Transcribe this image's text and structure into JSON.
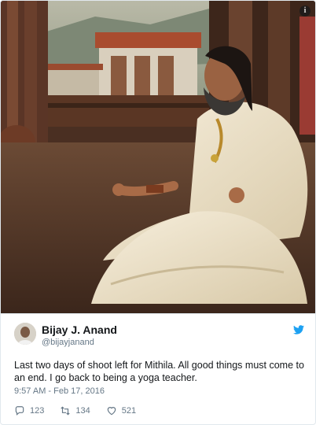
{
  "photo": {
    "info_icon": "info-icon"
  },
  "tweet": {
    "author": {
      "name": "Bijay J. Anand",
      "handle": "@bijayjanand",
      "avatar_icon": "avatar"
    },
    "text": "Last two days of shoot left for Mithila. All good things must come to an end. I go back to being a yoga teacher.",
    "timestamp": "9:57 AM - Feb 17, 2016",
    "actions": {
      "reply_count": "123",
      "retweet_count": "134",
      "like_count": "521"
    },
    "brand_color": "#1da1f2"
  }
}
